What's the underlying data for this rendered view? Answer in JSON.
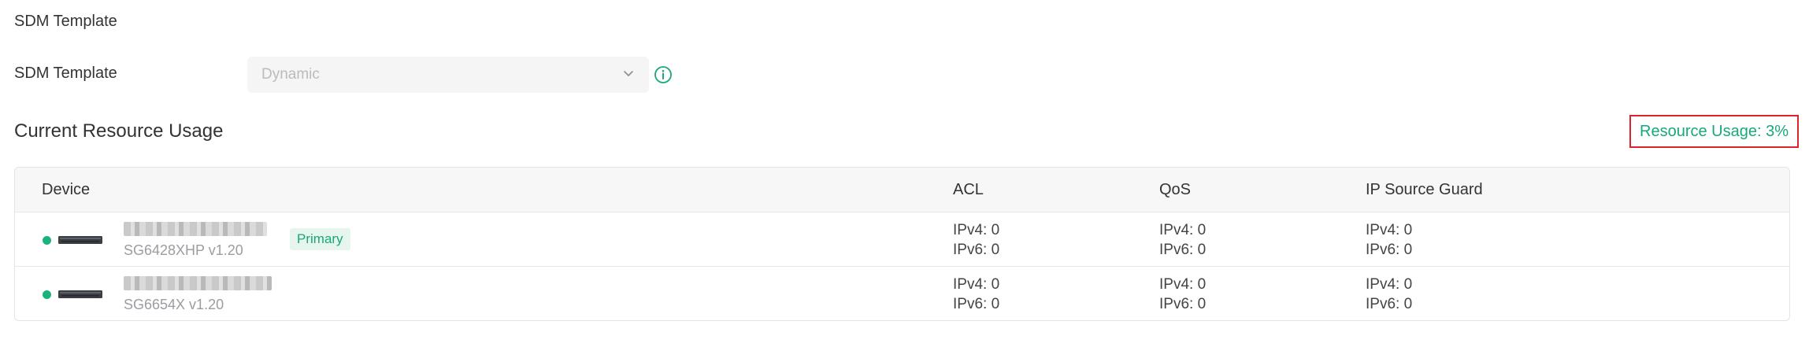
{
  "sdm": {
    "section_title": "SDM Template",
    "field_label": "SDM Template",
    "selected_value": "Dynamic"
  },
  "usage": {
    "title": "Current Resource Usage",
    "badge": "Resource Usage: 3%"
  },
  "table": {
    "headers": {
      "device": "Device",
      "acl": "ACL",
      "qos": "QoS",
      "ipsg": "IP Source Guard"
    },
    "rows": [
      {
        "status": "online",
        "model": "SG6428XHP v1.20",
        "badge": "Primary",
        "acl": {
          "ipv4": "IPv4: 0",
          "ipv6": "IPv6: 0"
        },
        "qos": {
          "ipv4": "IPv4: 0",
          "ipv6": "IPv6: 0"
        },
        "ipsg": {
          "ipv4": "IPv4: 0",
          "ipv6": "IPv6: 0"
        }
      },
      {
        "status": "online",
        "model": "SG6654X v1.20",
        "acl": {
          "ipv4": "IPv4: 0",
          "ipv6": "IPv6: 0"
        },
        "qos": {
          "ipv4": "IPv4: 0",
          "ipv6": "IPv6: 0"
        },
        "ipsg": {
          "ipv4": "IPv4: 0",
          "ipv6": "IPv6: 0"
        }
      }
    ]
  },
  "colors": {
    "accent": "#18a87a",
    "status_online": "#19b37b",
    "highlight_border": "#e0232b"
  },
  "icons": {
    "select_arrow": "chevron-down-icon",
    "info": "info-icon",
    "device": "switch-device-icon"
  }
}
